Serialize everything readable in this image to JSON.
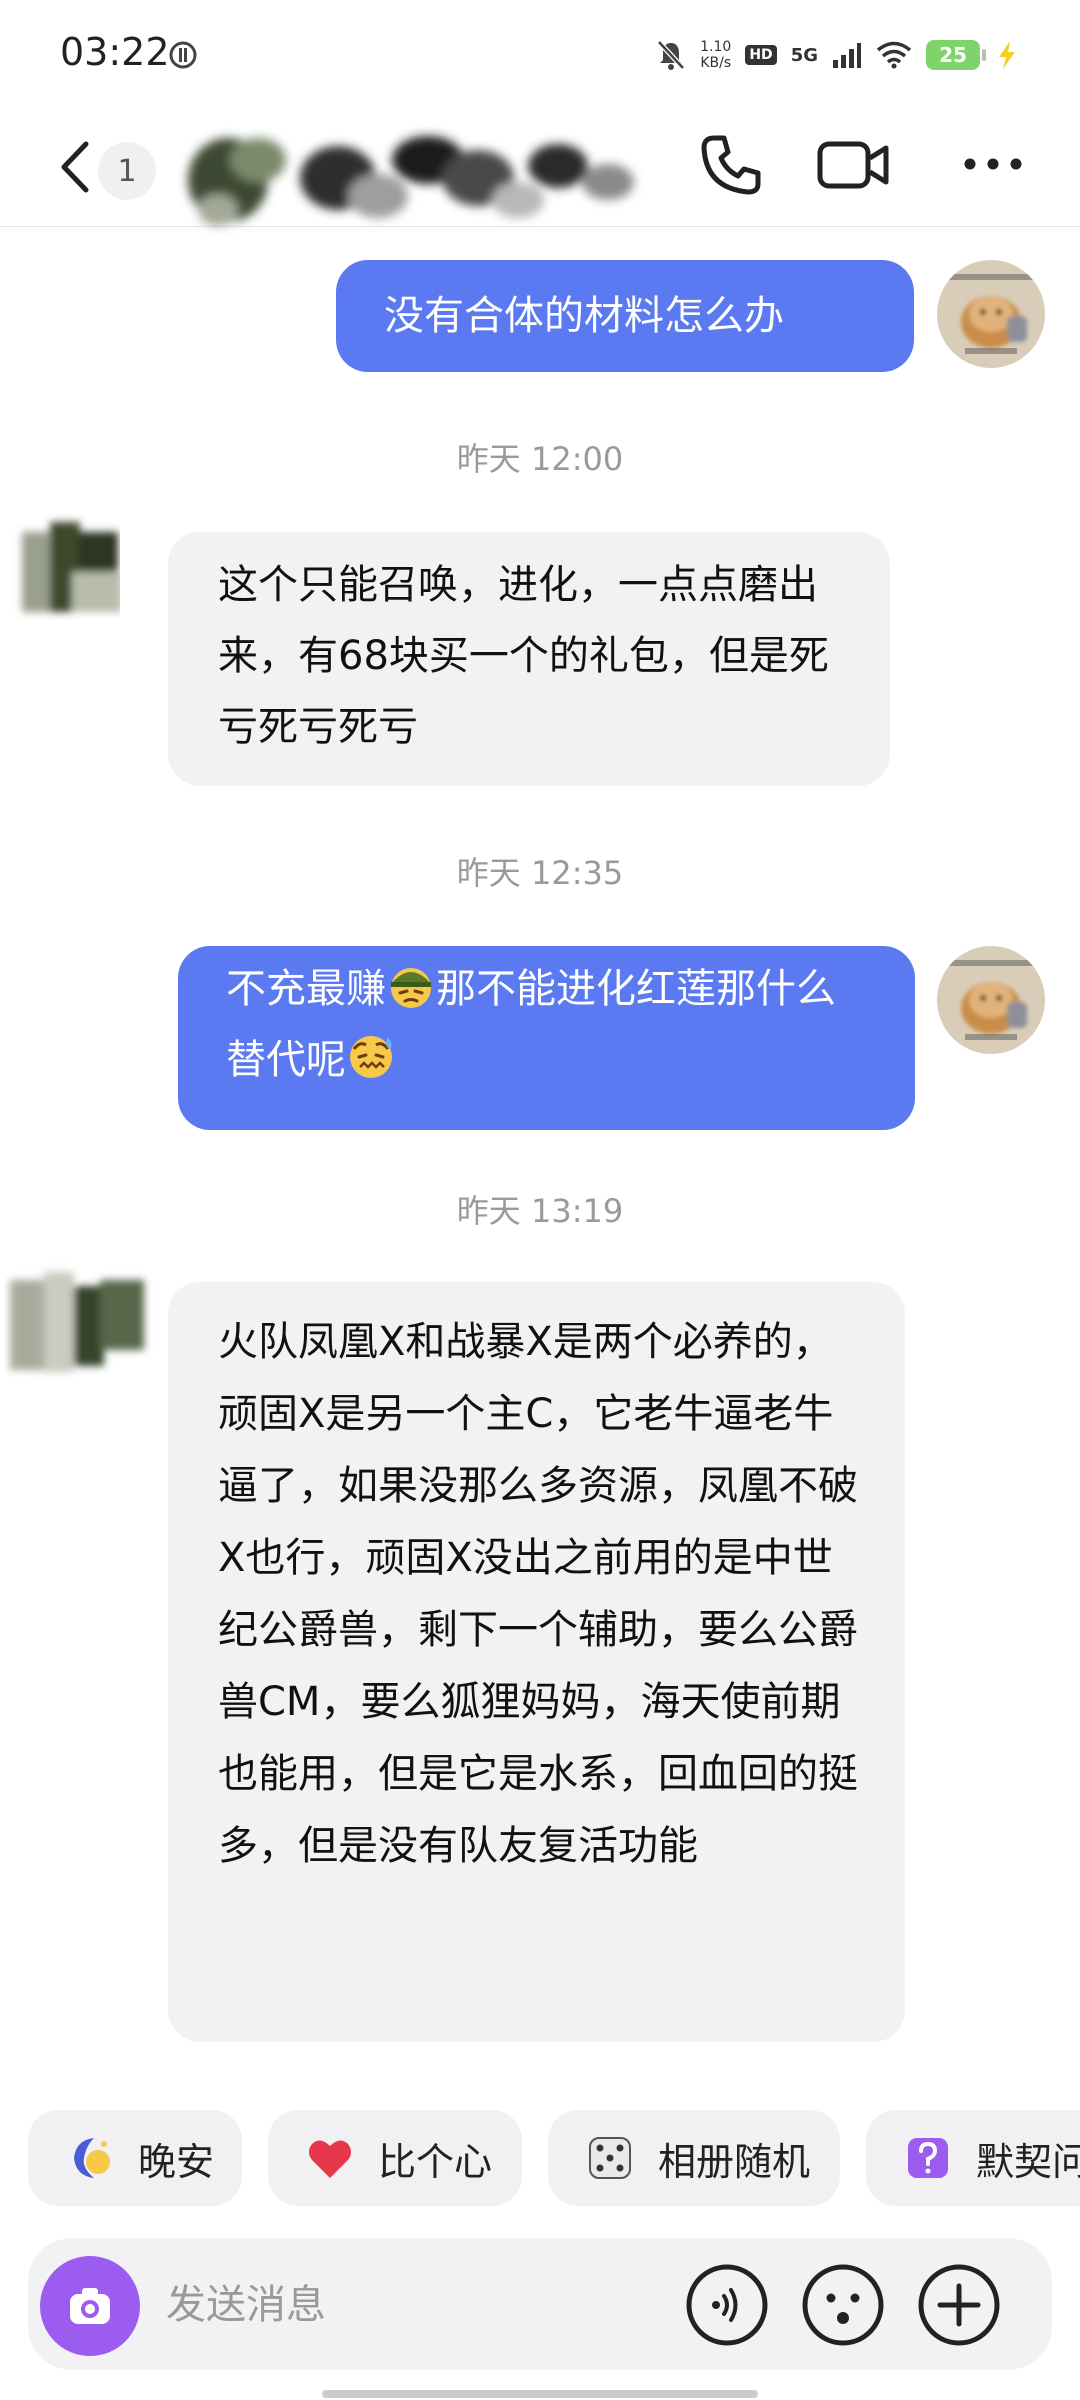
{
  "status_bar": {
    "time": "03:22",
    "net_speed_value": "1.10",
    "net_speed_unit": "KB/s",
    "hd_label": "HD",
    "network_label": "5G",
    "battery": "25"
  },
  "nav": {
    "unread_count": "1",
    "icons": [
      "back-icon",
      "phone-icon",
      "video-icon",
      "more-icon"
    ]
  },
  "messages": [
    {
      "sender": "me",
      "text": "没有合体的材料怎么办"
    },
    {
      "sender": "them",
      "time": "昨天 12:00",
      "text": "这个只能召唤，进化，一点点磨出来，有68块买一个的礼包，但是死亏死亏死亏"
    },
    {
      "sender": "me",
      "time": "昨天 12:35",
      "text_a": "不充最赚",
      "emoji_a": "soldier-emoji",
      "text_b": "那不能进化红莲那什么替代呢",
      "emoji_b": "sweat-emoji"
    },
    {
      "sender": "them",
      "time": "昨天 13:19",
      "text": "火队凤凰X和战暴X是两个必养的，顽固X是另一个主C，它老牛逼老牛逼了，如果没那么多资源，凤凰不破X也行，顽固X没出之前用的是中世纪公爵兽，剩下一个辅助，要么公爵兽CM，要么狐狸妈妈，海天使前期也能用，但是它是水系，回血回的挺多，但是没有队友复活功能"
    }
  ],
  "quick_actions": [
    {
      "label": "晚安",
      "icon": "moon-icon"
    },
    {
      "label": "比个心",
      "icon": "heart-icon"
    },
    {
      "label": "相册随机",
      "icon": "dice-icon"
    },
    {
      "label": "默契问",
      "icon": "question-icon"
    }
  ],
  "input": {
    "placeholder": "发送消息",
    "icons": [
      "camera-icon",
      "voice-icon",
      "emoji-icon",
      "plus-icon"
    ]
  },
  "colors": {
    "my_bubble": "#5b79f0",
    "their_bubble": "#f2f2f4",
    "camera_button": "#9c5cf0"
  }
}
